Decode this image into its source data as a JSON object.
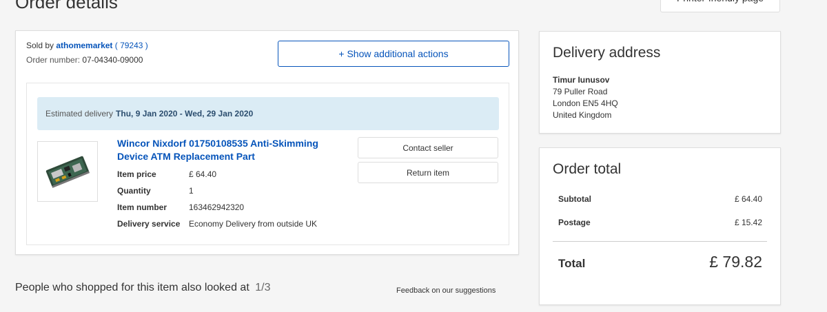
{
  "header": {
    "title": "Order details",
    "printer_label": "Printer-friendly page"
  },
  "order": {
    "sold_by_label": "Sold by",
    "seller_name": "athomemarket",
    "seller_score": "( 79243 )",
    "order_number_label": "Order number:",
    "order_number": "07-04340-09000",
    "actions_label": "+ Show additional actions",
    "delivery": {
      "label": "Estimated delivery",
      "dates": "Thu, 9 Jan 2020 - Wed, 29 Jan 2020"
    },
    "item": {
      "title": "Wincor Nixdorf 01750108535 Anti-Skimming Device ATM Replacement Part",
      "details": [
        {
          "label": "Item price",
          "value": "£ 64.40"
        },
        {
          "label": "Quantity",
          "value": "1"
        },
        {
          "label": "Item number",
          "value": "163462942320"
        },
        {
          "label": "Delivery service",
          "value": "Economy Delivery from outside UK"
        }
      ],
      "contact_label": "Contact seller",
      "return_label": "Return item"
    }
  },
  "suggestions": {
    "title": "People who shopped for this item also looked at",
    "page": "1/3",
    "feedback_label": "Feedback on our suggestions"
  },
  "address": {
    "heading": "Delivery address",
    "name": "Timur Iunusov",
    "lines": [
      "79 Puller Road",
      "London EN5 4HQ",
      "United Kingdom"
    ]
  },
  "totals": {
    "heading": "Order total",
    "subtotal_label": "Subtotal",
    "subtotal_value": "£ 64.40",
    "postage_label": "Postage",
    "postage_value": "£ 15.42",
    "total_label": "Total",
    "total_value": "£ 79.82"
  },
  "colors": {
    "link": "#0654ba",
    "banner": "#dbecf5",
    "background": "#f5f5f5"
  }
}
